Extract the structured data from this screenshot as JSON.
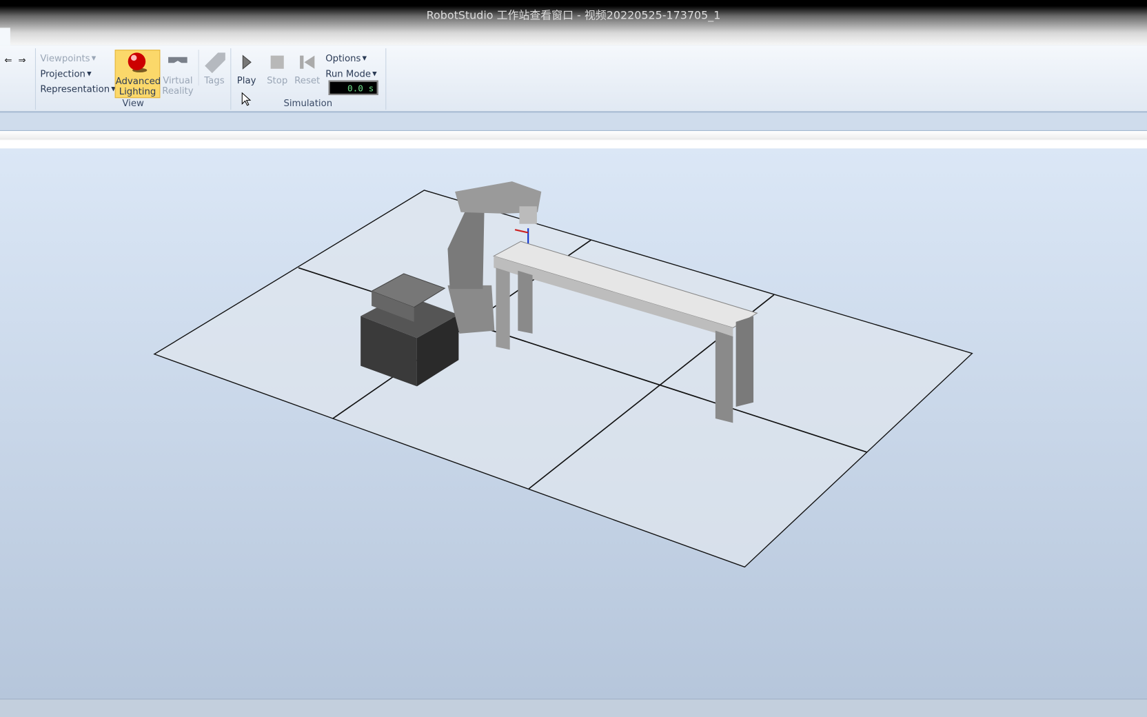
{
  "window": {
    "title": "RobotStudio 工作站查看窗口 - 视频20220525-173705_1"
  },
  "nav": {
    "back_icon": "arrow-left-icon",
    "forward_icon": "arrow-right-icon"
  },
  "ribbon": {
    "view": {
      "label": "View",
      "viewpoints": "Viewpoints",
      "projection": "Projection",
      "representation": "Representation",
      "advanced_lighting_1": "Advanced",
      "advanced_lighting_2": "Lighting",
      "virtual_reality_1": "Virtual",
      "virtual_reality_2": "Reality",
      "tags": "Tags"
    },
    "simulation": {
      "label": "Simulation",
      "play": "Play",
      "stop": "Stop",
      "reset": "Reset",
      "options": "Options",
      "run_mode": "Run Mode",
      "time": "0.0 s"
    }
  },
  "colors": {
    "accent_highlight": "#fbd86a",
    "timer_text": "#6fe08a"
  }
}
